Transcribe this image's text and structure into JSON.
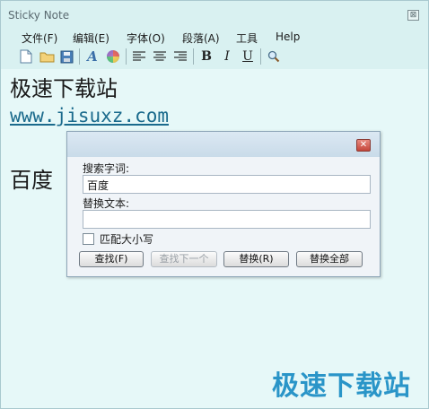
{
  "window": {
    "title": "Sticky Note",
    "close_glyph": "⊠"
  },
  "menu": [
    "文件(F)",
    "编辑(E)",
    "字体(O)",
    "段落(A)",
    "工具",
    "Help"
  ],
  "toolbar": {
    "icons": [
      "new-icon",
      "open-folder-icon",
      "save-icon",
      "font-icon",
      "color-palette-icon",
      "align-left-icon",
      "align-center-icon",
      "align-right-icon",
      "bold-icon",
      "italic-icon",
      "underline-icon",
      "search-icon"
    ],
    "bold": "B",
    "italic": "I",
    "underline": "U",
    "font": "A"
  },
  "editor": {
    "line1": "极速下载站",
    "line2": "www.jisuxz.com",
    "line3": "百度"
  },
  "watermark": "极速下载站",
  "dialog": {
    "close_glyph": "✕",
    "search_label": "搜索字词:",
    "search_value": "百度",
    "replace_label": "替换文本:",
    "replace_value": "",
    "match_case_label": "匹配大小写",
    "buttons": {
      "find": "查找(F)",
      "find_next": "查找下一个",
      "replace": "替换(R)",
      "replace_all": "替换全部"
    }
  }
}
